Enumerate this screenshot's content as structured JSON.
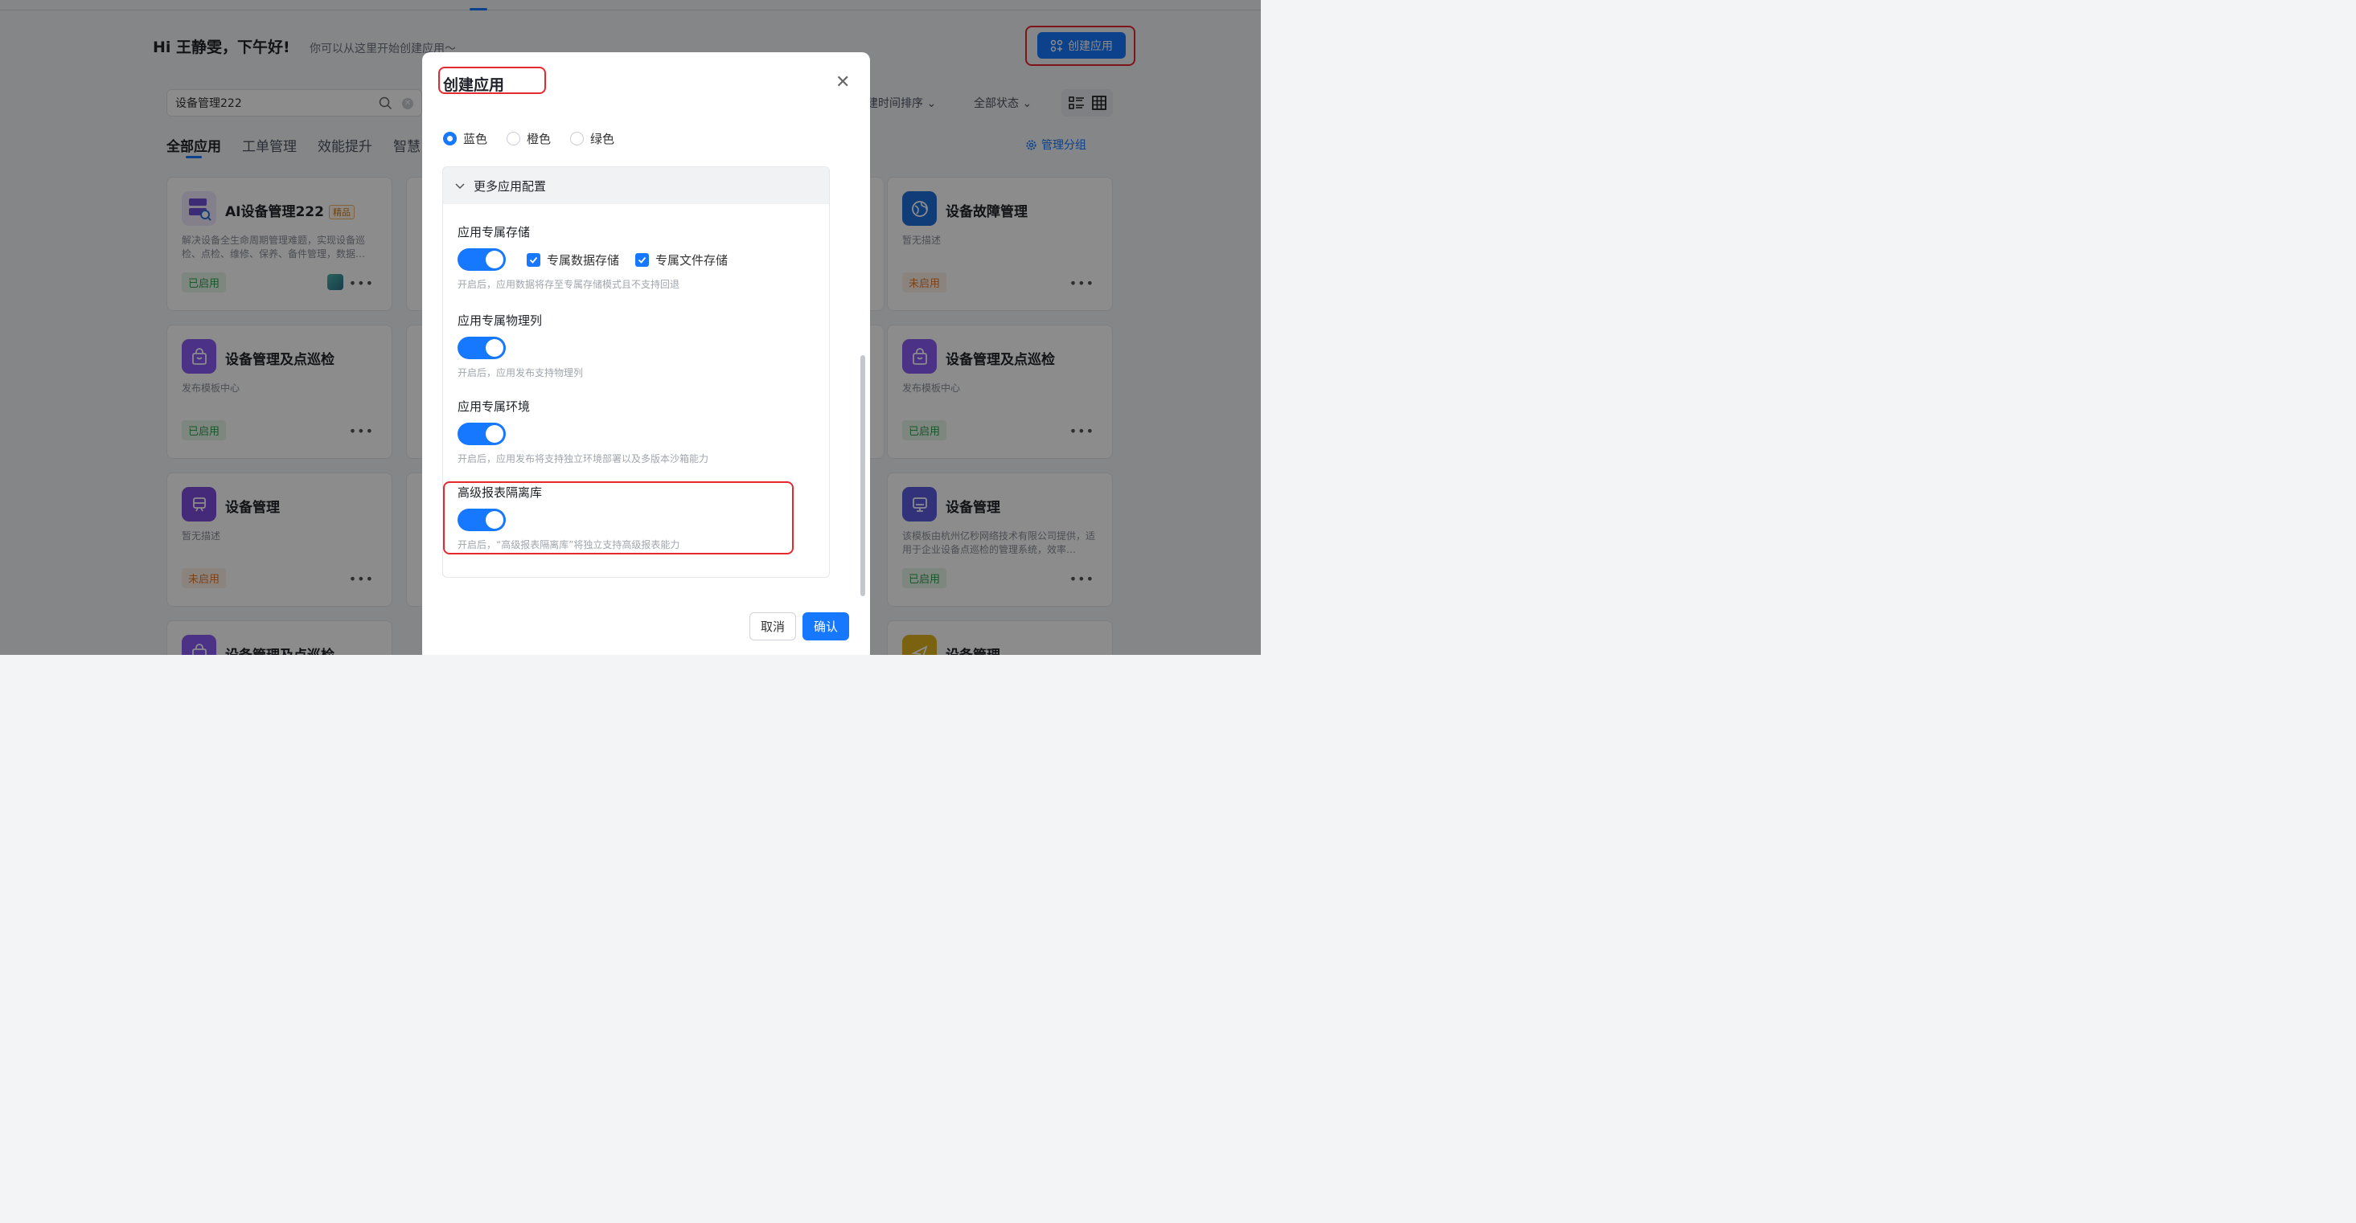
{
  "header": {
    "greeting": "Hi 王静雯，下午好!",
    "subtitle": "你可以从这里开始创建应用～",
    "create_button": "创建应用"
  },
  "toolbar": {
    "search_value": "设备管理222",
    "sort_label": "建时间排序",
    "status_filter": "全部状态"
  },
  "tabs": [
    {
      "label": "全部应用"
    },
    {
      "label": "工单管理"
    },
    {
      "label": "效能提升"
    },
    {
      "label": "智慧"
    }
  ],
  "manage_groups": "管理分组",
  "cards": {
    "c1": {
      "title": "AI设备管理222",
      "tag": "精品",
      "desc": "解决设备全生命周期管理难题，实现设备巡检、点检、维修、保养、备件管理，数据…",
      "status": "已启用",
      "icon_color": "#6f4fd8"
    },
    "c2": {
      "title": "设备管理及点巡检",
      "desc": "发布模板中心",
      "status": "已启用",
      "icon_color": "#8b5cf6"
    },
    "c3": {
      "title": "设备管理",
      "desc": "暂无描述",
      "status": "未启用",
      "icon_color": "#7c4ddc"
    },
    "c4": {
      "title": "设备管理及点巡检",
      "icon_color": "#8b5cf6"
    },
    "c5": {
      "title": "设备故障管理",
      "desc": "暂无描述",
      "status": "未启用",
      "icon_color": "#1e6fd9"
    },
    "c6": {
      "title": "设备管理及点巡检",
      "desc": "发布模板中心",
      "status": "已启用",
      "icon_color": "#8b5cf6"
    },
    "c7": {
      "title": "设备管理",
      "desc": "该模板由杭州亿秒网络技术有限公司提供，适用于企业设备点巡检的管理系统，效率…",
      "status": "已启用",
      "icon_color": "#5b5ce0"
    },
    "c8": {
      "title": "设备管理",
      "icon_color": "#e0b320"
    }
  },
  "modal": {
    "title": "创建应用",
    "colors": [
      {
        "label": "蓝色",
        "selected": true
      },
      {
        "label": "橙色",
        "selected": false
      },
      {
        "label": "绿色",
        "selected": false
      }
    ],
    "panel_title": "更多应用配置",
    "storage": {
      "title": "应用专属存储",
      "cb_data": "专属数据存储",
      "cb_file": "专属文件存储",
      "hint": "开启后，应用数据将存至专属存储模式且不支持回退"
    },
    "physical": {
      "title": "应用专属物理列",
      "hint": "开启后，应用发布支持物理列"
    },
    "env": {
      "title": "应用专属环境",
      "hint": "开启后，应用发布将支持独立环境部署以及多版本沙箱能力"
    },
    "report": {
      "title": "高级报表隔离库",
      "hint": "开启后，“高级报表隔离库”将独立支持高级报表能力"
    },
    "cancel": "取消",
    "confirm": "确认"
  }
}
